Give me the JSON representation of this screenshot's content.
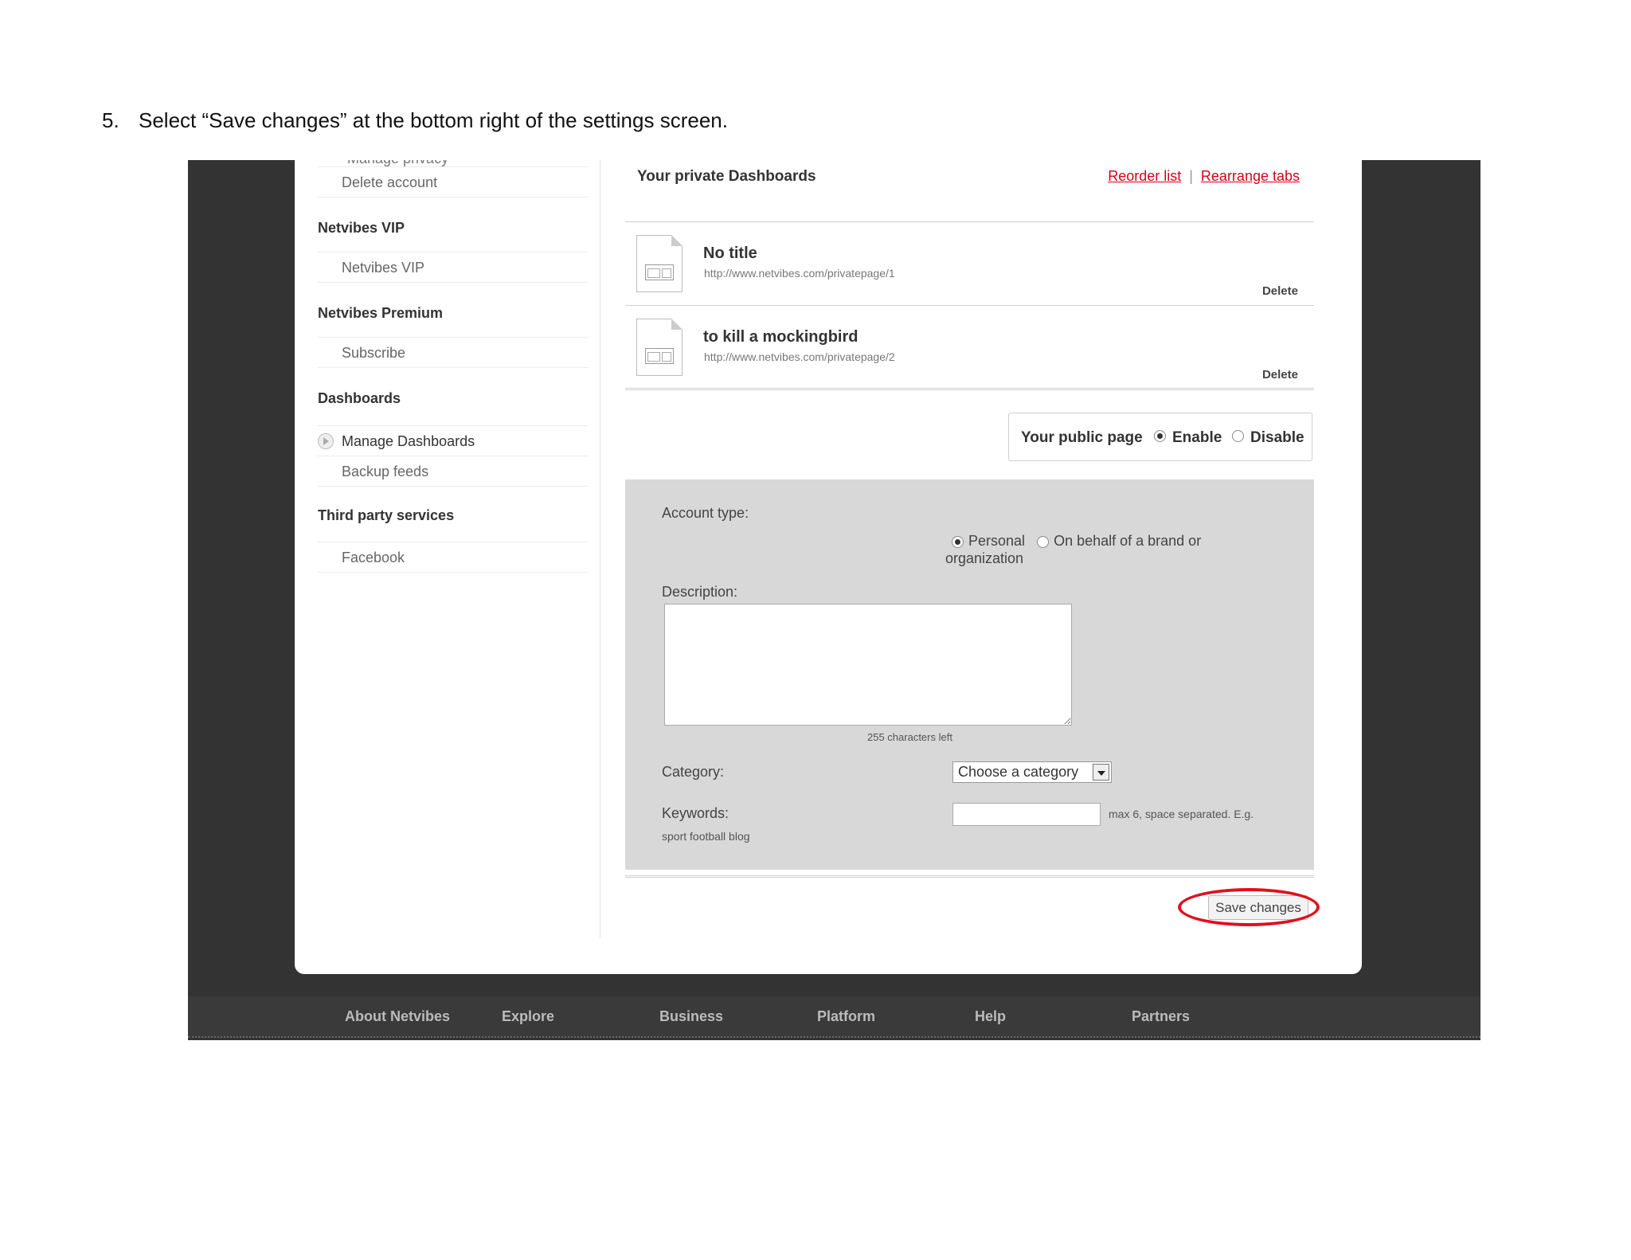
{
  "instruction": {
    "number": "5.",
    "text": "Select “Save changes” at the bottom right of the settings screen."
  },
  "sidebar": {
    "cut_label": "Manage privacy",
    "delete_account": "Delete account",
    "vip_heading": "Netvibes VIP",
    "vip_item": "Netvibes VIP",
    "premium_heading": "Netvibes Premium",
    "premium_item": "Subscribe",
    "dashboards_heading": "Dashboards",
    "manage_dashboards": "Manage Dashboards",
    "backup_feeds": "Backup feeds",
    "third_party_heading": "Third party services",
    "facebook": "Facebook"
  },
  "dashboards": {
    "title": "Your private Dashboards",
    "reorder_link": "Reorder list",
    "separator": "|",
    "rearrange_link": "Rearrange tabs",
    "items": [
      {
        "name": "No title",
        "url": "http://www.netvibes.com/privatepage/1",
        "delete": "Delete"
      },
      {
        "name": "to kill a mockingbird",
        "url": "http://www.netvibes.com/privatepage/2",
        "delete": "Delete"
      }
    ]
  },
  "public_page": {
    "label": "Your public page",
    "enable": "Enable",
    "disable": "Disable",
    "selected": "Enable"
  },
  "form": {
    "account_type_label": "Account type:",
    "personal": "Personal",
    "organization": "On behalf of a brand or organization",
    "description_label": "Description:",
    "chars_left": "255 characters left",
    "category_label": "Category:",
    "category_value": "Choose a category",
    "keywords_label": "Keywords:",
    "keywords_hint": "max 6, space separated. E.g.",
    "keywords_example": "sport football blog"
  },
  "save_button": "Save changes",
  "footer": {
    "links": [
      "About Netvibes",
      "Explore",
      "Business",
      "Platform",
      "Help",
      "Partners"
    ]
  },
  "colors": {
    "link_red": "#d9001b",
    "highlight_ring": "#e0101e",
    "frame_dark": "#333333",
    "form_bg": "#d8d8d8"
  }
}
